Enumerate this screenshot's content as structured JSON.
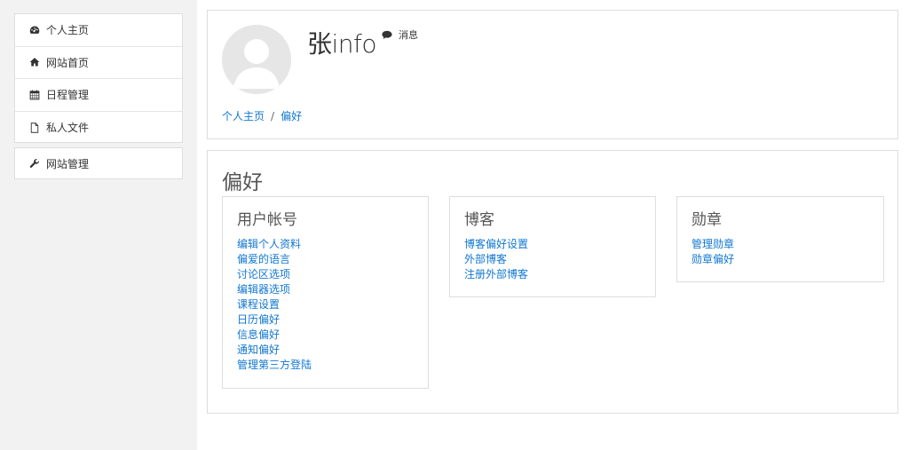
{
  "nav": {
    "main": [
      {
        "label": "个人主页",
        "icon": "dashboard-icon"
      },
      {
        "label": "网站首页",
        "icon": "home-icon"
      },
      {
        "label": "日程管理",
        "icon": "calendar-icon"
      },
      {
        "label": "私人文件",
        "icon": "file-icon"
      }
    ],
    "admin": [
      {
        "label": "网站管理",
        "icon": "wrench-icon"
      }
    ]
  },
  "header": {
    "username": "张info",
    "message_label": "消息",
    "breadcrumb": [
      "个人主页",
      "偏好"
    ]
  },
  "main": {
    "title": "偏好",
    "categories": [
      {
        "title": "用户帐号",
        "links": [
          "编辑个人资料",
          "偏爱的语言",
          "讨论区选项",
          "编辑器选项",
          "课程设置",
          "日历偏好",
          "信息偏好",
          "通知偏好",
          "管理第三方登陆"
        ]
      },
      {
        "title": "博客",
        "links": [
          "博客偏好设置",
          "外部博客",
          "注册外部博客"
        ]
      },
      {
        "title": "勋章",
        "links": [
          "管理勋章",
          "勋章偏好"
        ]
      }
    ]
  },
  "colors": {
    "link": "#1177d1",
    "sidebar_bg": "#f2f2f2",
    "border": "#dedede"
  }
}
